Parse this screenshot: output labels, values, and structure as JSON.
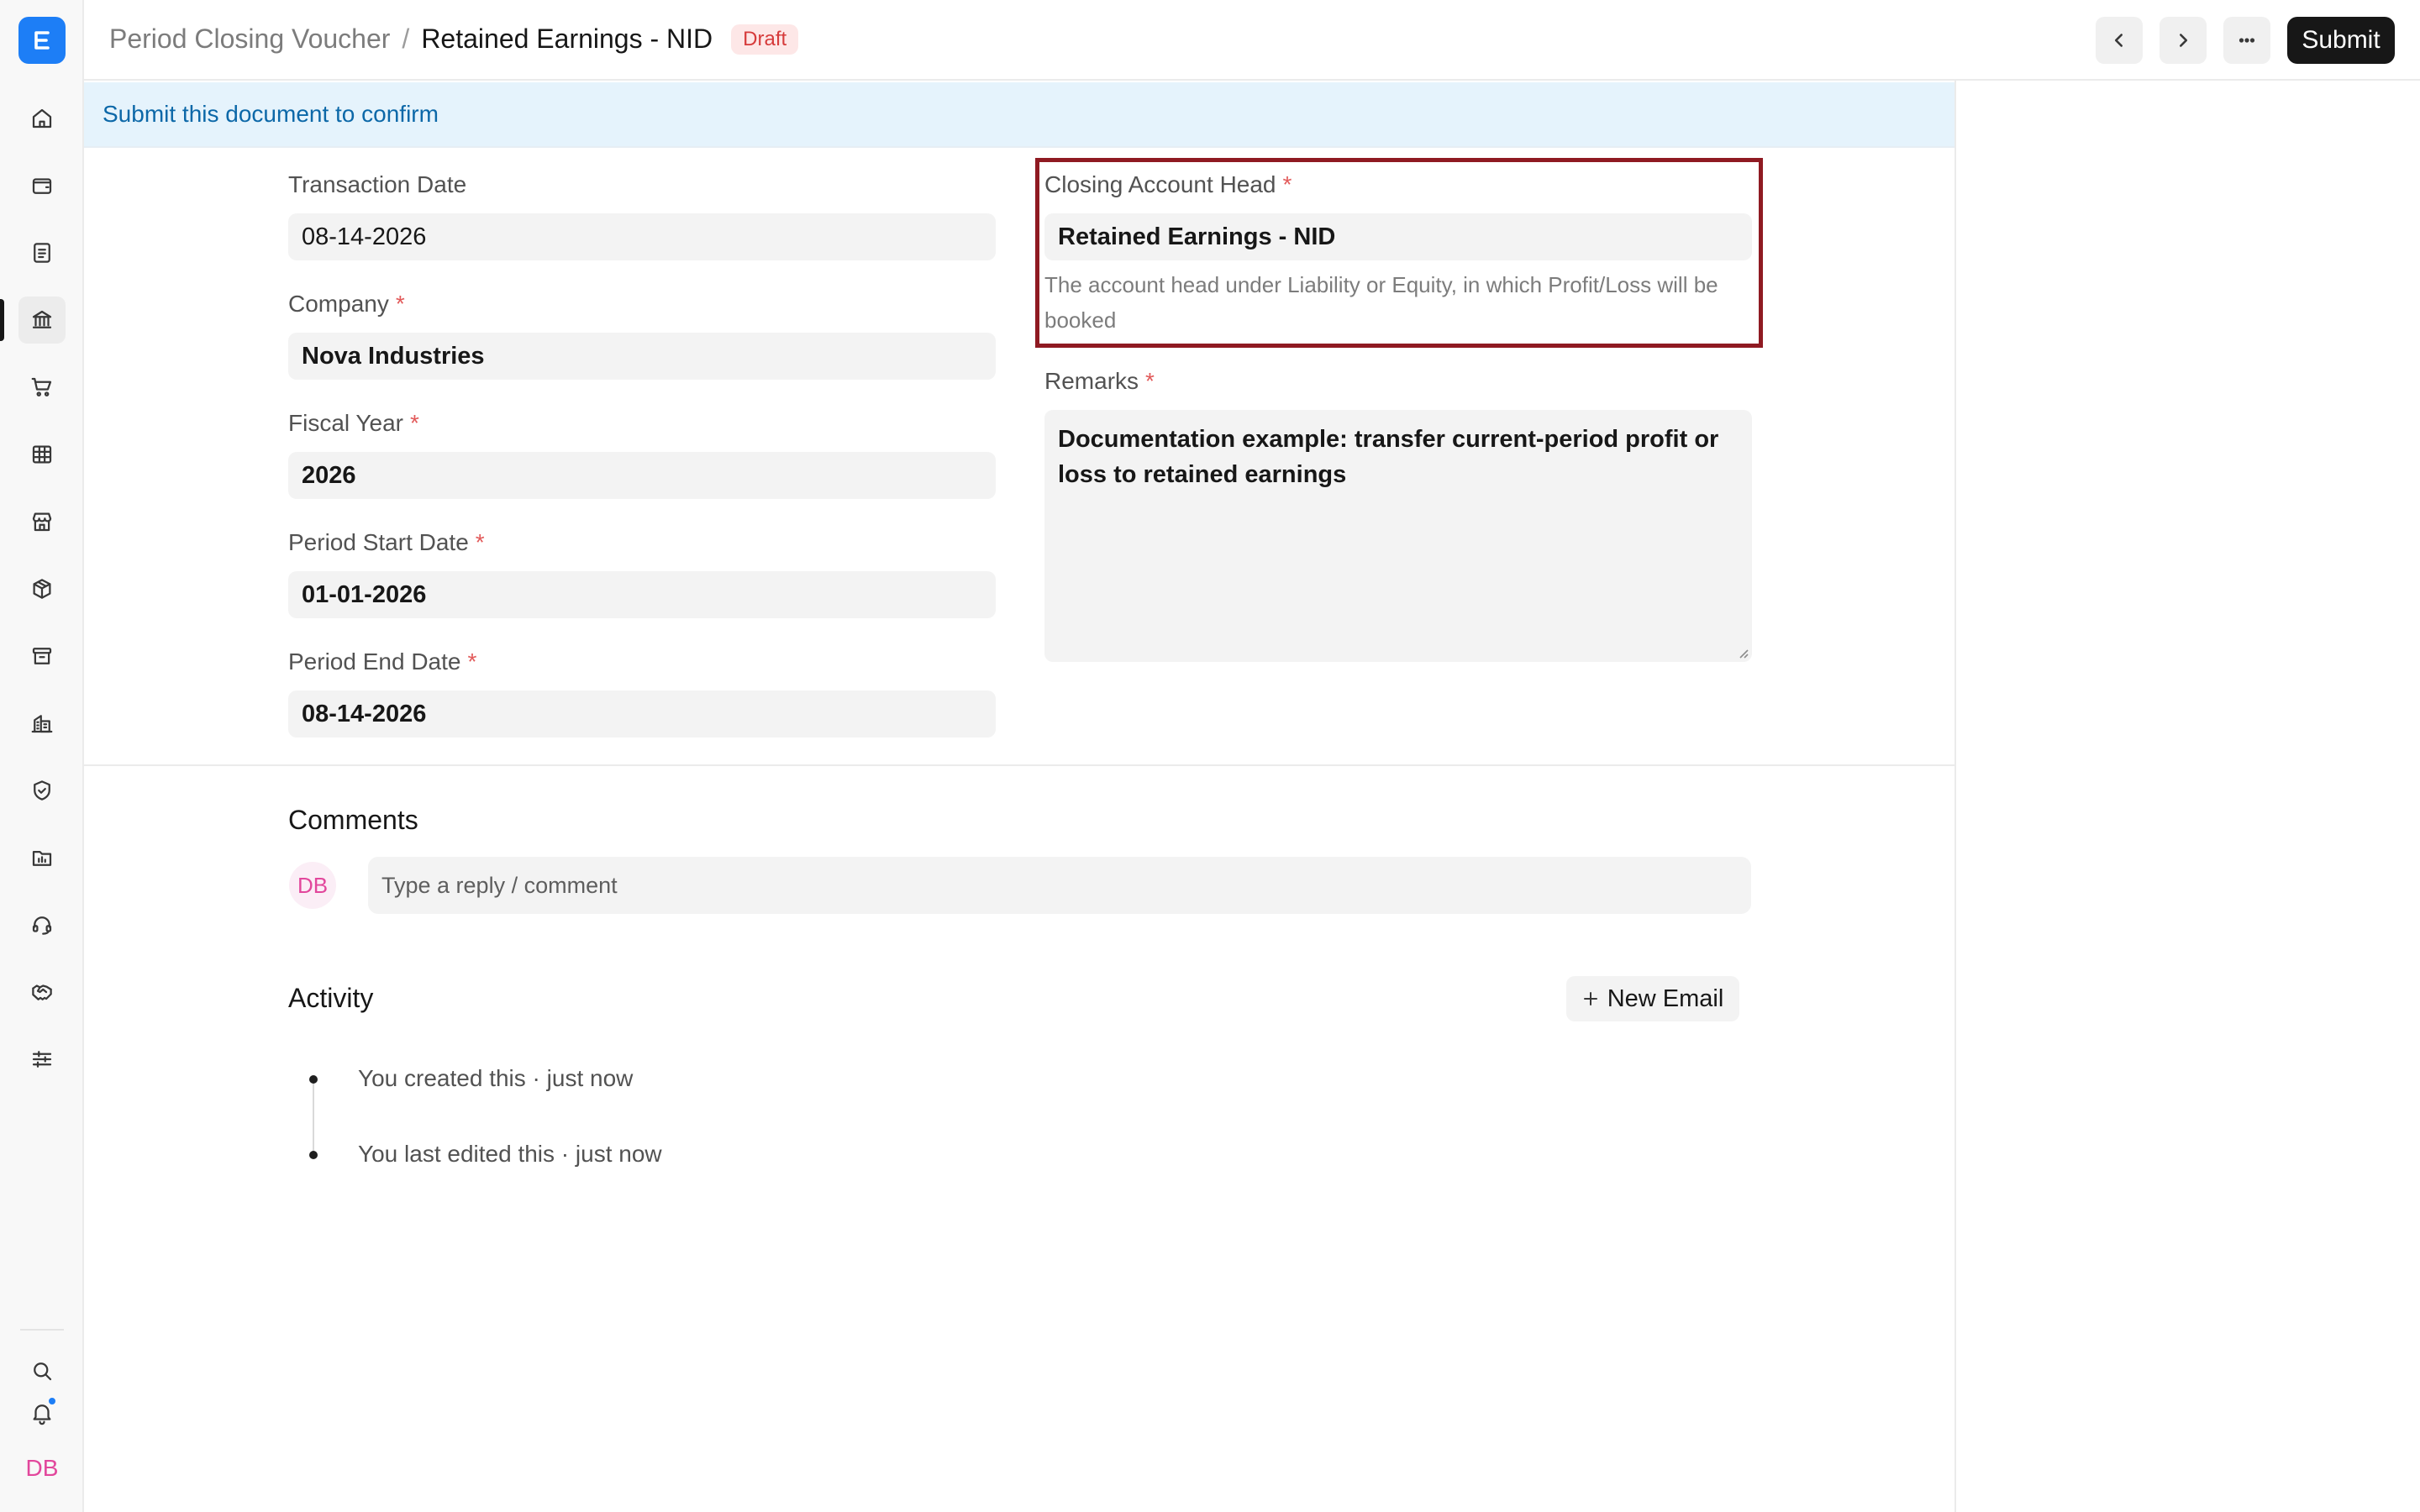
{
  "header": {
    "breadcrumb_parent": "Period Closing Voucher",
    "breadcrumb_separator": "/",
    "title": "Retained Earnings - NID",
    "status_badge": "Draft",
    "submit_label": "Submit"
  },
  "banner": {
    "text": "Submit this document to confirm"
  },
  "form": {
    "transaction_date": {
      "label": "Transaction Date",
      "value": "08-14-2026"
    },
    "company": {
      "label": "Company",
      "required": "*",
      "value": "Nova Industries"
    },
    "fiscal_year": {
      "label": "Fiscal Year",
      "required": "*",
      "value": "2026"
    },
    "period_start_date": {
      "label": "Period Start Date",
      "required": "*",
      "value": "01-01-2026"
    },
    "period_end_date": {
      "label": "Period End Date",
      "required": "*",
      "value": "08-14-2026"
    },
    "closing_account_head": {
      "label": "Closing Account Head",
      "required": "*",
      "value": "Retained Earnings - NID",
      "help": "The account head under Liability or Equity, in which Profit/Loss will be booked"
    },
    "remarks": {
      "label": "Remarks",
      "required": "*",
      "value": "Documentation example: transfer current-period profit or loss to retained earnings"
    }
  },
  "comments": {
    "title": "Comments",
    "avatar": "DB",
    "placeholder": "Type a reply / comment"
  },
  "activity": {
    "title": "Activity",
    "new_email_label": "New Email",
    "items": [
      "You created this · just now",
      "You last edited this · just now"
    ]
  },
  "sidebar": {
    "user_initials": "DB",
    "icons": [
      "home-icon",
      "wallet-icon",
      "document-icon",
      "bank-icon",
      "cart-icon",
      "table-icon",
      "store-icon",
      "package-icon",
      "archive-icon",
      "buildings-icon",
      "shield-icon",
      "folder-chart-icon",
      "headset-icon",
      "handshake-icon",
      "sliders-icon",
      "search-icon",
      "bell-icon"
    ]
  },
  "colors": {
    "accent": "#1d7ef6",
    "highlight_border": "#8f1a22",
    "banner_bg": "#e5f3fc",
    "banner_text": "#0c68a8",
    "badge_text": "#d63b3b"
  }
}
